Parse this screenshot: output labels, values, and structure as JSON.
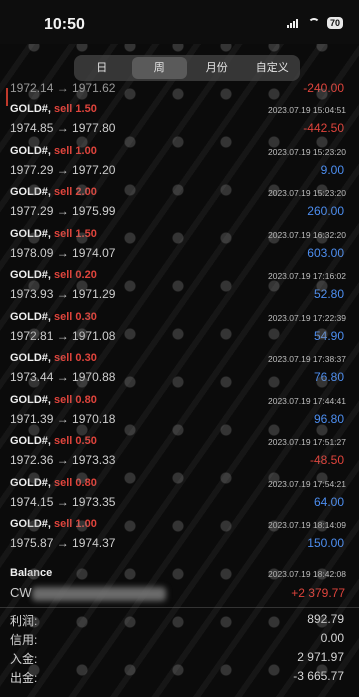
{
  "status": {
    "time": "10:50",
    "battery": "70"
  },
  "tabs": [
    {
      "label": "日",
      "active": false
    },
    {
      "label": "周",
      "active": true
    },
    {
      "label": "月份",
      "active": false
    },
    {
      "label": "自定义",
      "active": false
    }
  ],
  "partial_top": {
    "price": "1972.14 → 1971.62",
    "pnl": "-240.00"
  },
  "trades": [
    {
      "symbol": "GOLD#,",
      "action": "sell 1.50",
      "date": "2023.07.19 15:04:51",
      "price": "1974.85 → 1977.80",
      "pnl": "-442.50",
      "sign": "neg"
    },
    {
      "symbol": "GOLD#,",
      "action": "sell 1.00",
      "date": "2023.07.19 15:23:20",
      "price": "1977.29 → 1977.20",
      "pnl": "9.00",
      "sign": "pos"
    },
    {
      "symbol": "GOLD#,",
      "action": "sell 2.00",
      "date": "2023.07.19 15:23:20",
      "price": "1977.29 → 1975.99",
      "pnl": "260.00",
      "sign": "pos"
    },
    {
      "symbol": "GOLD#,",
      "action": "sell 1.50",
      "date": "2023.07.19 16:32:20",
      "price": "1978.09 → 1974.07",
      "pnl": "603.00",
      "sign": "pos"
    },
    {
      "symbol": "GOLD#,",
      "action": "sell 0.20",
      "date": "2023.07.19 17:16:02",
      "price": "1973.93 → 1971.29",
      "pnl": "52.80",
      "sign": "pos"
    },
    {
      "symbol": "GOLD#,",
      "action": "sell 0.30",
      "date": "2023.07.19 17:22:39",
      "price": "1972.81 → 1971.08",
      "pnl": "54.90",
      "sign": "pos"
    },
    {
      "symbol": "GOLD#,",
      "action": "sell 0.30",
      "date": "2023.07.19 17:38:37",
      "price": "1973.44 → 1970.88",
      "pnl": "76.80",
      "sign": "pos"
    },
    {
      "symbol": "GOLD#,",
      "action": "sell 0.80",
      "date": "2023.07.19 17:44:41",
      "price": "1971.39 → 1970.18",
      "pnl": "96.80",
      "sign": "pos"
    },
    {
      "symbol": "GOLD#,",
      "action": "sell 0.50",
      "date": "2023.07.19 17:51:27",
      "price": "1972.36 → 1973.33",
      "pnl": "-48.50",
      "sign": "neg"
    },
    {
      "symbol": "GOLD#,",
      "action": "sell 0.80",
      "date": "2023.07.19 17:54:21",
      "price": "1974.15 → 1973.35",
      "pnl": "64.00",
      "sign": "pos"
    },
    {
      "symbol": "GOLD#,",
      "action": "sell 1.00",
      "date": "2023.07.19 18:14:09",
      "price": "1975.87 → 1974.37",
      "pnl": "150.00",
      "sign": "pos"
    }
  ],
  "balance": {
    "label": "Balance",
    "date": "2023.07.19 18:42:08",
    "cw": "CW",
    "value": "+2 379.77"
  },
  "summary": [
    {
      "label": "利润:",
      "value": "892.79"
    },
    {
      "label": "信用:",
      "value": "0.00"
    },
    {
      "label": "入金:",
      "value": "2 971.97"
    },
    {
      "label": "出金:",
      "value": "-3 665.77"
    }
  ]
}
